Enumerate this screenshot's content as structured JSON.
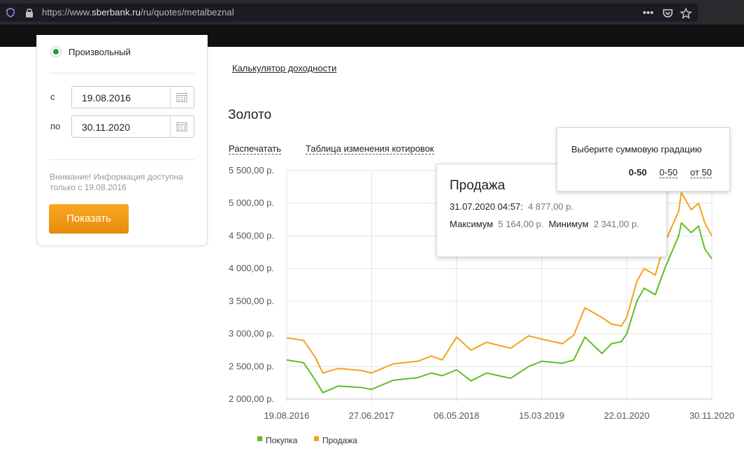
{
  "browser": {
    "url_scheme": "https://www.",
    "url_domain": "sberbank.ru",
    "url_path": "/ru/quotes/metalbeznal",
    "icons": [
      "shield-icon",
      "lock-icon",
      "more-icon",
      "pocket-icon",
      "bookmark-star-icon"
    ]
  },
  "filter": {
    "radio_label": "Произвольный",
    "from_label": "с",
    "from_value": "19.08.2016",
    "to_label": "по",
    "to_value": "30.11.2020",
    "notice": "Внимание! Информация доступна только с 19.08.2016",
    "show_button": "Показать"
  },
  "main": {
    "calculator_link": "Калькулятор доходности",
    "metal_title": "Золото",
    "print_link": "Распечатать",
    "table_link": "Таблица изменения котировок"
  },
  "tooltip": {
    "title": "Продажа",
    "datetime": "31.07.2020 04:57:",
    "value": "4 877,00 р.",
    "max_label": "Максимум",
    "max_value": "5 164,00 р.",
    "min_label": "Минимум",
    "min_value": "2 341,00 р."
  },
  "gradation": {
    "title": "Выберите суммовую градацию",
    "options": [
      "0-50",
      "0-50",
      "от 50"
    ],
    "selected_index": 0
  },
  "chart_data": {
    "type": "line",
    "title": "",
    "ylim": [
      2000,
      5500
    ],
    "yticks": [
      "5 500,00 р.",
      "5 000,00 р.",
      "4 500,00 р.",
      "4 000,00 р.",
      "3 500,00 р.",
      "3 000,00 р.",
      "2 500,00 р.",
      "2 000,00 р."
    ],
    "ytick_values": [
      5500,
      5000,
      4500,
      4000,
      3500,
      3000,
      2500,
      2000
    ],
    "xticks": [
      "19.08.2016",
      "27.06.2017",
      "06.05.2018",
      "15.03.2019",
      "22.01.2020",
      "30.11.2020"
    ],
    "grid": true,
    "legend_position": "bottom-left",
    "x": [
      "19.08.2016",
      "20.10.2016",
      "01.12.2016",
      "30.12.2016",
      "24.02.2017",
      "20.05.2017",
      "27.06.2017",
      "15.09.2017",
      "14.12.2017",
      "02.02.2018",
      "14.03.2018",
      "06.05.2018",
      "28.06.2018",
      "24.08.2018",
      "21.11.2018",
      "26.01.2019",
      "15.03.2019",
      "30.05.2019",
      "11.07.2019",
      "21.08.2019",
      "23.10.2019",
      "27.11.2019",
      "02.01.2020",
      "22.01.2020",
      "28.02.2020",
      "26.03.2020",
      "06.05.2020",
      "10.06.2020",
      "31.07.2020",
      "10.08.2020",
      "15.09.2020",
      "12.10.2020",
      "04.11.2020",
      "30.11.2020"
    ],
    "series": [
      {
        "name": "Покупка",
        "color": "#5cbf24",
        "values": [
          2600,
          2560,
          2300,
          2100,
          2200,
          2180,
          2150,
          2290,
          2330,
          2400,
          2360,
          2450,
          2280,
          2400,
          2320,
          2500,
          2580,
          2550,
          2600,
          2950,
          2700,
          2850,
          2880,
          3000,
          3500,
          3700,
          3600,
          4000,
          4500,
          4700,
          4550,
          4650,
          4300,
          4150
        ]
      },
      {
        "name": "Продажа",
        "color": "#f7a01a",
        "values": [
          2940,
          2900,
          2650,
          2400,
          2470,
          2440,
          2400,
          2540,
          2580,
          2660,
          2600,
          2950,
          2750,
          2870,
          2780,
          2970,
          2920,
          2850,
          2980,
          3400,
          3250,
          3150,
          3120,
          3250,
          3800,
          4000,
          3900,
          4400,
          4877,
          5164,
          4900,
          5000,
          4700,
          4500
        ]
      }
    ]
  }
}
